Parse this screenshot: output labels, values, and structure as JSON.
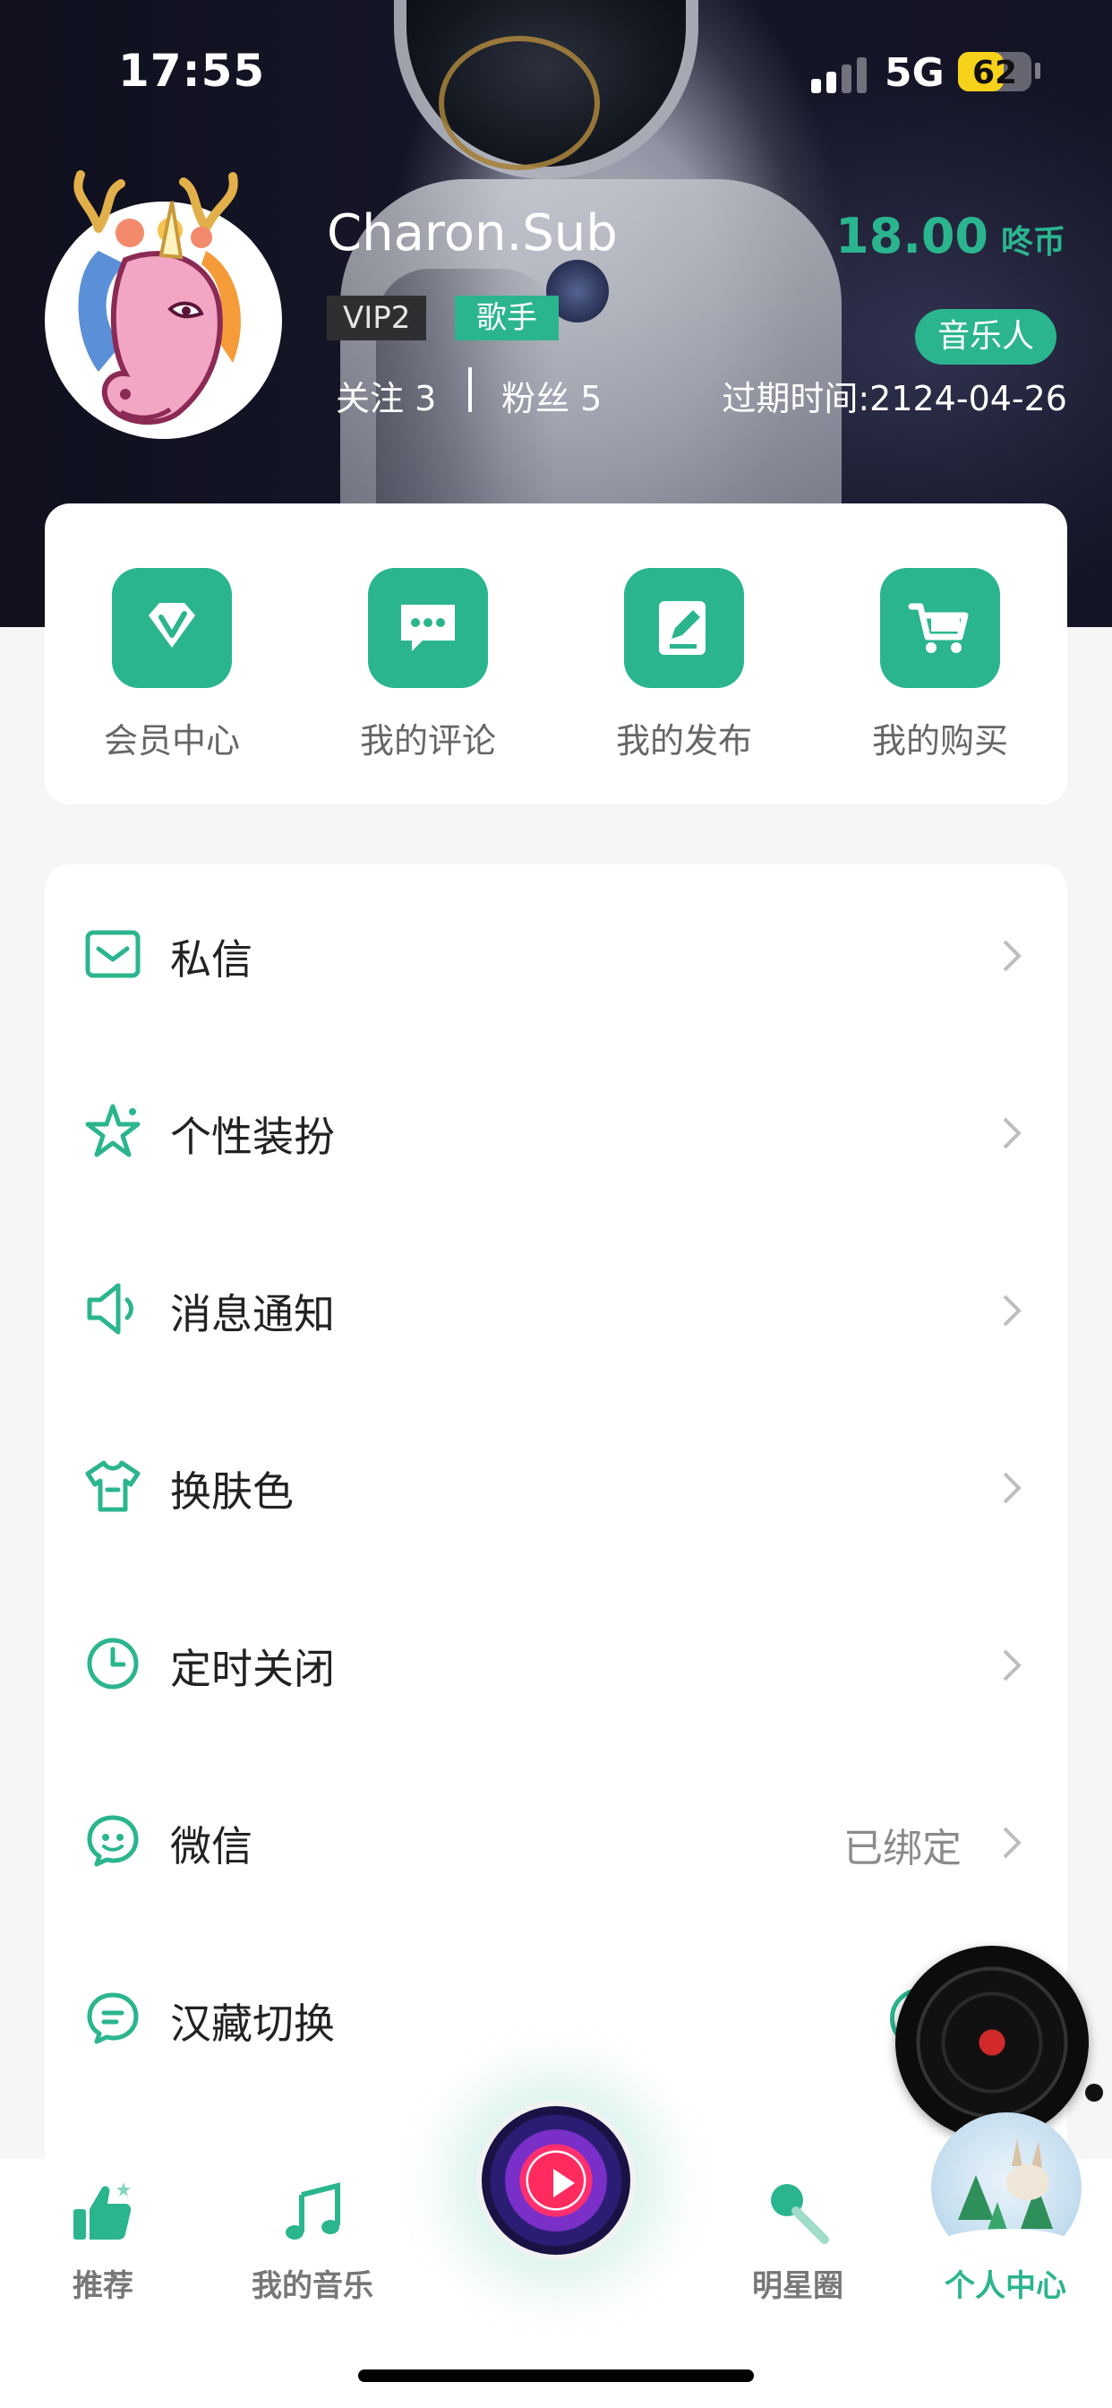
{
  "status_bar": {
    "time": "17:55",
    "network": "5G",
    "battery": "62",
    "battery_level": 0.62
  },
  "profile": {
    "username": "Charon.Sub",
    "vip_tag": "VIP2",
    "role_tag": "歌手",
    "follow_label": "关注",
    "follow_count": "3",
    "fans_label": "粉丝",
    "fans_count": "5",
    "coins_value": "18.00",
    "coins_unit": "咚币",
    "musician_button": "音乐人",
    "expire_text": "过期时间:2124-04-26"
  },
  "quick_actions": [
    {
      "label": "会员中心",
      "icon": "vip-diamond-icon"
    },
    {
      "label": "我的评论",
      "icon": "comment-icon"
    },
    {
      "label": "我的发布",
      "icon": "edit-post-icon"
    },
    {
      "label": "我的购买",
      "icon": "cart-icon"
    }
  ],
  "menu": [
    {
      "label": "私信",
      "icon": "mail-icon",
      "value": ""
    },
    {
      "label": "个性装扮",
      "icon": "star-icon",
      "value": ""
    },
    {
      "label": "消息通知",
      "icon": "speaker-icon",
      "value": ""
    },
    {
      "label": "换肤色",
      "icon": "tshirt-icon",
      "value": ""
    },
    {
      "label": "定时关闭",
      "icon": "clock-icon",
      "value": ""
    },
    {
      "label": "微信",
      "icon": "wechat-icon",
      "value": "已绑定"
    },
    {
      "label": "汉藏切换",
      "icon": "language-icon",
      "value": ""
    }
  ],
  "tabs": [
    {
      "label": "推荐",
      "icon": "thumbs-up-icon"
    },
    {
      "label": "我的音乐",
      "icon": "music-note-icon"
    },
    {
      "label": "明星圈",
      "icon": "mic-icon"
    },
    {
      "label": "个人中心",
      "icon": "profile-avatar-icon"
    }
  ],
  "colors": {
    "accent": "#2bb58f",
    "tab_active": "#2bb58f",
    "tab_inactive": "#777777",
    "battery": "#f7d21a"
  }
}
